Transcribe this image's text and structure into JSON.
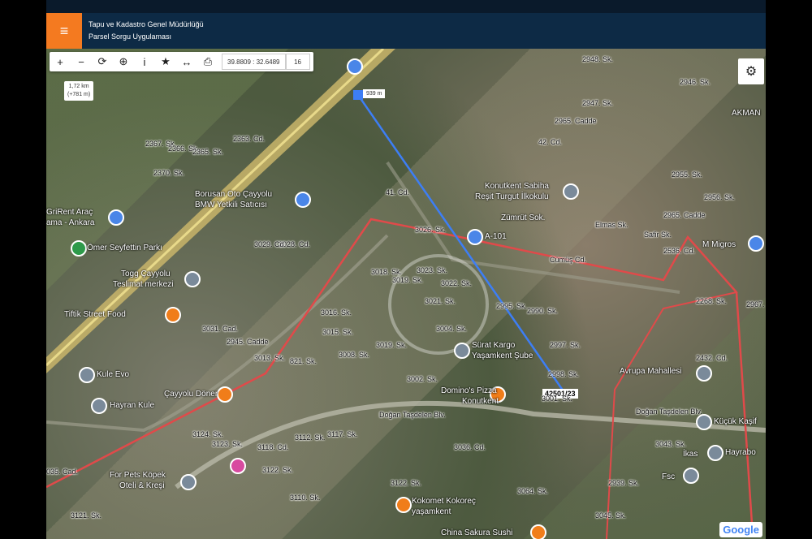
{
  "header": {
    "title_line1": "Tapu ve Kadastro Genel Müdürlüğü",
    "title_line2": "Parsel Sorgu Uygulaması",
    "menu_icon": "hamburger-icon"
  },
  "toolbar": {
    "buttons": [
      {
        "name": "zoom-in-button",
        "glyph": "+"
      },
      {
        "name": "zoom-out-button",
        "glyph": "−"
      },
      {
        "name": "refresh-button",
        "glyph": "⟳"
      },
      {
        "name": "locate-button",
        "glyph": "⊕"
      },
      {
        "name": "info-button",
        "glyph": "i"
      },
      {
        "name": "favorite-button",
        "glyph": "★"
      },
      {
        "name": "measure-button",
        "glyph": "↔"
      },
      {
        "name": "print-button",
        "glyph": "⎙"
      }
    ],
    "coordinates": "39.8809 : 32.6489",
    "zoom_level": "16"
  },
  "scale": {
    "line1": "1,72 km",
    "line2": "(+781 m)"
  },
  "measurement": {
    "distance": "939 m"
  },
  "parcel": {
    "label": "42501/23"
  },
  "settings_icon": "gear-icon",
  "map_labels": {
    "places": [
      "Borusan Oto Çayyolu",
      "BMW Yetkili Satıcısı",
      "Ömer Seyfettin Parkı",
      "Togg Çayyolu",
      "Teslimat merkezi",
      "Tiftik Street Food",
      "Kule Evo",
      "Hayran Kule",
      "Çayyolu Döner",
      "For Pets Köpek",
      "Oteli & Kreşi",
      "Kokomet Kokoreç",
      "yaşamkent",
      "China Sakura Sushi",
      "Domino's Pizza",
      "Konutkent",
      "Sürat Kargo",
      "Yaşamkent Şube",
      "A-101",
      "Konutkent Sabiha",
      "Reşit Turgut İlkokulu",
      "Zümrüt Sok.",
      "M Migros",
      "Avrupa Mahallesi",
      "Küçük Kaşif",
      "Hayrabo",
      "Fsc",
      "İkas",
      "AKMAN",
      "GriRent Araç",
      "ama - Ankara"
    ],
    "roads": [
      "2948. Sk.",
      "2946. Sk.",
      "2947. Sk.",
      "2965. Cadde",
      "2955. Sk.",
      "2956. Sk.",
      "2965. Cadde",
      "Elmas Sk.",
      "Safir Sk.",
      "41. Cd.",
      "42. Cd.",
      "3026. Sk.",
      "Cümüş Cd.",
      "2536. Cd.",
      "2268. Sk.",
      "2967.",
      "3018. Sk.",
      "3019. Sk.",
      "3023. Sk.",
      "3022. Sk.",
      "3021. Sk.",
      "2995. Sk.",
      "2990. Sk.",
      "2997. Sk.",
      "2998. Sk.",
      "3001. Sk.",
      "3002. Sk.",
      "3004. Sk.",
      "3008. Sk.",
      "3015. Sk.",
      "3016. Sk.",
      "821. Sk.",
      "3019. Sk.",
      "3013. Sk.",
      "2945. Cadde",
      "3031. Cad.",
      "3028. Cd.",
      "3029. Cd.",
      "2367. Sk.",
      "2366. Sk.",
      "2365. Sk.",
      "2363. Cd.",
      "2370. Sk.",
      "Doğan Taşdelen Blv.",
      "Doğan Taşdelen Blv.",
      "3124. Sk.",
      "3123. Sk.",
      "3118. Cd.",
      "3112. Sk.",
      "3122. Sk.",
      "3117. Sk.",
      "3110. Sk.",
      "3036. Cd.",
      "3064. Sk.",
      "3043. Sk.",
      "2939. Sk.",
      "3045. Sk.",
      "2432. Cd.",
      "035. Cad.",
      "3122. Sk.",
      "3121. Sk."
    ]
  },
  "google_logo": "Google"
}
